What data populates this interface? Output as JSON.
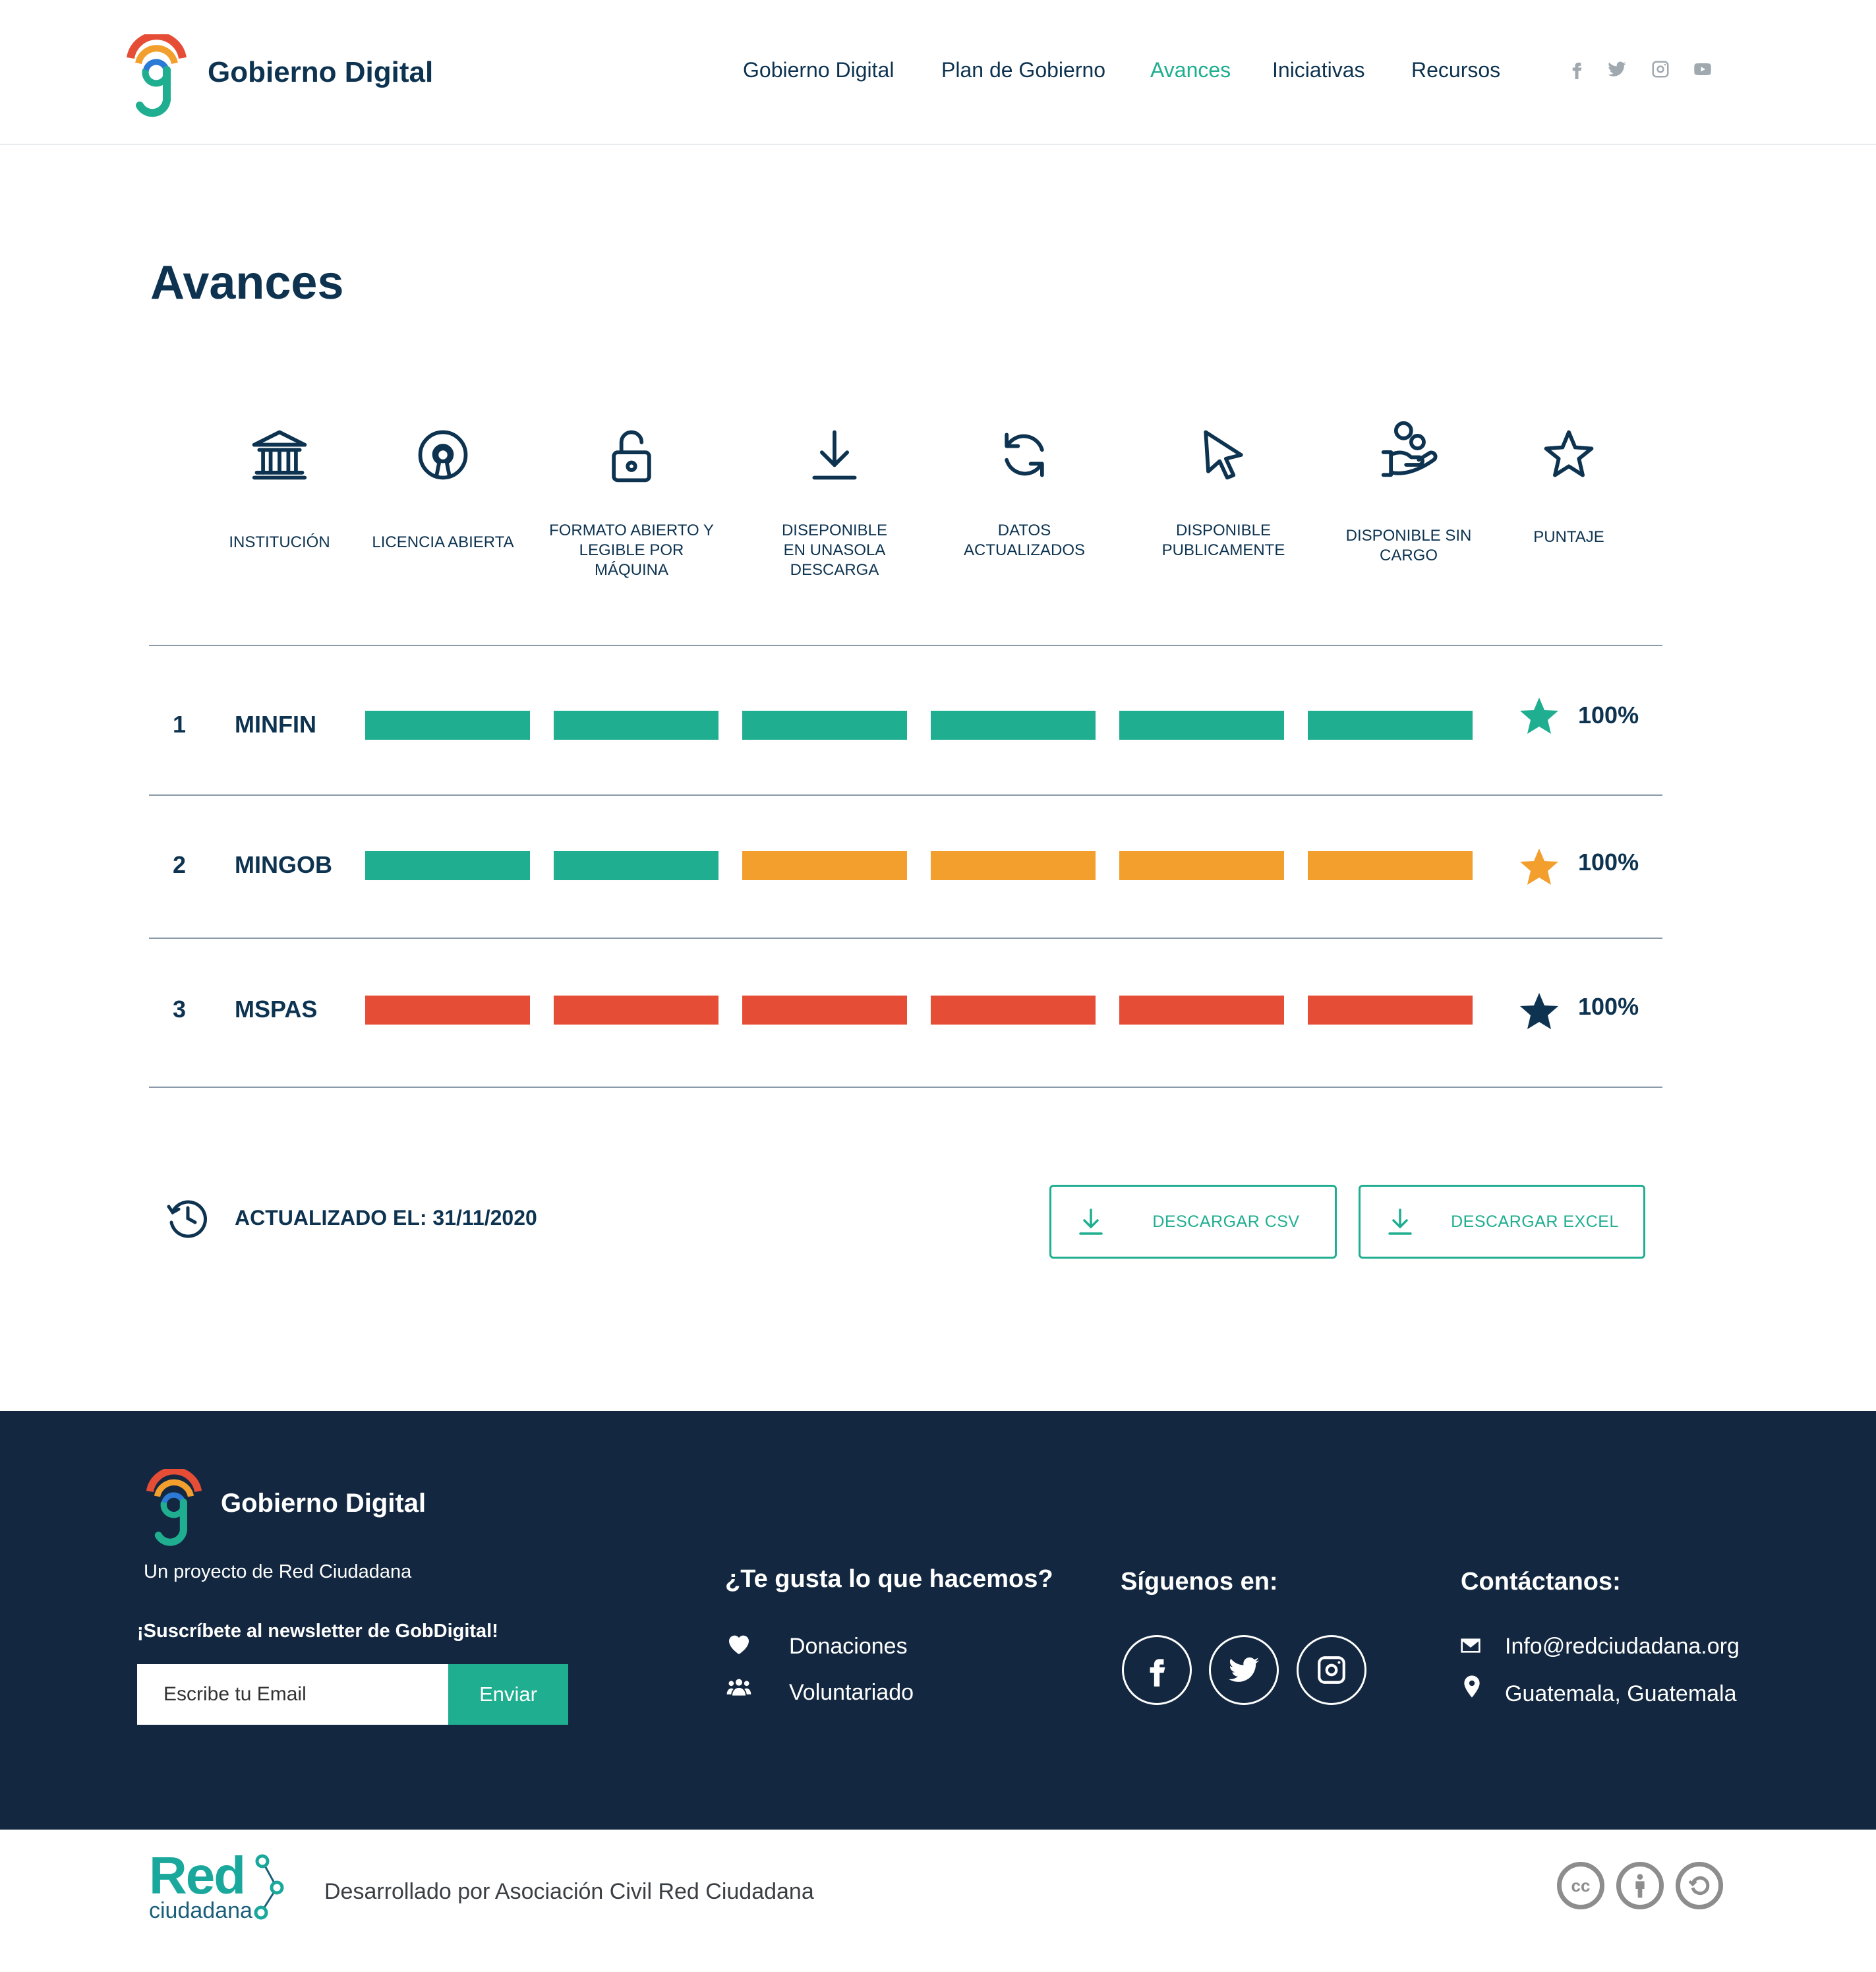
{
  "header": {
    "brand": "Gobierno Digital",
    "nav": [
      {
        "label": "Gobierno Digital",
        "active": false
      },
      {
        "label": "Plan de Gobierno",
        "active": false
      },
      {
        "label": "Avances",
        "active": true
      },
      {
        "label": "Iniciativas",
        "active": false
      },
      {
        "label": "Recursos",
        "active": false
      }
    ],
    "social_icons": [
      "facebook-icon",
      "twitter-icon",
      "instagram-icon",
      "youtube-icon"
    ]
  },
  "page": {
    "title": "Avances"
  },
  "columns": [
    {
      "label": "INSTITUCIÓN",
      "icon": "institution-icon"
    },
    {
      "label": "LICENCIA ABIERTA",
      "icon": "open-license-icon"
    },
    {
      "label": "FORMATO ABIERTO Y LEGIBLE POR MÁQUINA",
      "icon": "unlock-icon"
    },
    {
      "label": "DISEPONIBLE EN UNASOLA DESCARGA",
      "icon": "download-icon"
    },
    {
      "label": "DATOS ACTUALIZADOS",
      "icon": "refresh-icon"
    },
    {
      "label": "DISPONIBLE PUBLICAMENTE",
      "icon": "cursor-icon"
    },
    {
      "label": "DISPONIBLE SIN CARGO",
      "icon": "hand-coins-icon"
    },
    {
      "label": "PUNTAJE",
      "icon": "star-outline-icon"
    }
  ],
  "colors": {
    "green": "#1fae90",
    "orange": "#f29f2d",
    "red": "#e54d36",
    "navy": "#0d3350"
  },
  "rows": [
    {
      "rank": "1",
      "institution": "MINFIN",
      "bars": [
        "green",
        "green",
        "green",
        "green",
        "green",
        "green"
      ],
      "star_color": "#1fae90",
      "score": "100%"
    },
    {
      "rank": "2",
      "institution": "MINGOB",
      "bars": [
        "green",
        "green",
        "orange",
        "orange",
        "orange",
        "orange"
      ],
      "star_color": "#f29f2d",
      "score": "100%"
    },
    {
      "rank": "3",
      "institution": "MSPAS",
      "bars": [
        "red",
        "red",
        "red",
        "red",
        "red",
        "red"
      ],
      "star_color": "#0d3350",
      "score": "100%"
    }
  ],
  "updated": "ACTUALIZADO EL: 31/11/2020",
  "buttons": {
    "csv": "DESCARGAR CSV",
    "excel": "DESCARGAR EXCEL"
  },
  "footer": {
    "brand": "Gobierno Digital",
    "subtitle": "Un proyecto de Red Ciudadana",
    "newsletter": "¡Suscríbete al newsletter de GobDigital!",
    "email_placeholder": "Escribe tu Email",
    "send": "Enviar",
    "support_title": "¿Te gusta lo que hacemos?",
    "support_links": [
      "Donaciones",
      "Voluntariado"
    ],
    "follow_title": "Síguenos en:",
    "contact_title": "Contáctanos:",
    "email": "Info@redciudadana.org",
    "location": "Guatemala, Guatemala"
  },
  "bottom": {
    "logo_word": "Red",
    "logo_sub": "ciudadana",
    "developed_by": "Desarrollado por Asociación Civil Red Ciudadana",
    "license_icons": [
      "cc-icon",
      "by-icon",
      "sa-icon"
    ]
  }
}
